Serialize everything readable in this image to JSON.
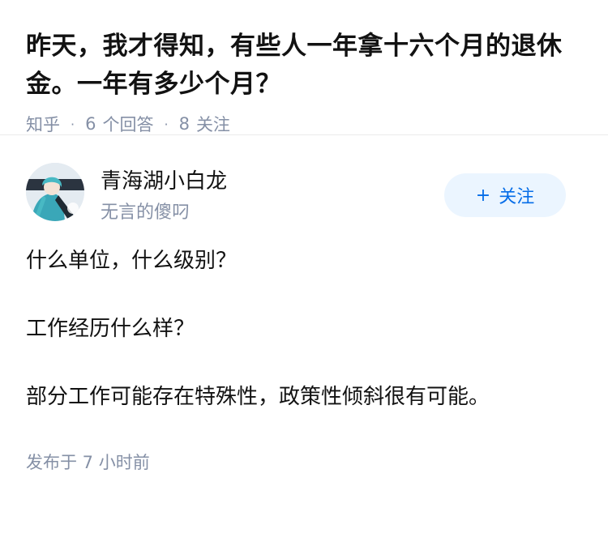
{
  "question": {
    "title": "昨天，我才得知，有些人一年拿十六个月的退休金。一年有多少个月？",
    "source": "知乎",
    "answers_count": "6",
    "answers_label": "个回答",
    "followers_count": "8",
    "followers_label": "关注"
  },
  "answer": {
    "author": {
      "name": "青海湖小白龙",
      "bio": "无言的傻叼"
    },
    "follow_button": {
      "icon": "plus-icon",
      "plus": "+",
      "label": "关注"
    },
    "paragraphs": [
      "什么单位，什么级别？",
      "工作经历什么样？",
      "部分工作可能存在特殊性，政策性倾斜很有可能。"
    ],
    "publish_time": "发布于 7 小时前"
  },
  "colors": {
    "meta_gray": "#8590a6",
    "follow_bg": "#ebf5ff",
    "follow_text": "#056de8"
  }
}
